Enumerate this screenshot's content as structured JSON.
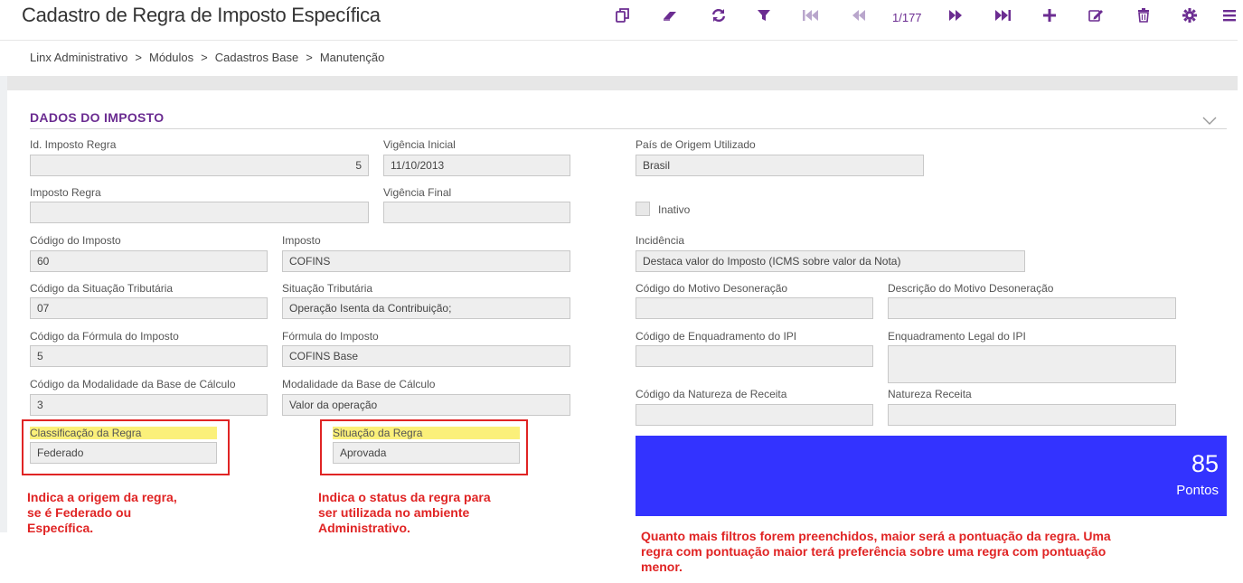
{
  "header": {
    "title": "Cadastro de Regra de Imposto Específica",
    "pager": "1/177"
  },
  "toolbar": {
    "icons": [
      "copy-icon",
      "eraser-icon",
      "refresh-icon",
      "filter-icon",
      "first-record-icon",
      "previous-record-icon",
      "next-record-icon",
      "last-record-icon",
      "add-icon",
      "edit-icon",
      "delete-icon",
      "settings-icon",
      "menu-icon"
    ]
  },
  "breadcrumb": {
    "items": [
      "Linx Administrativo",
      "Módulos",
      "Cadastros Base",
      "Manutenção"
    ],
    "separator": ">"
  },
  "section": {
    "title": "DADOS DO IMPOSTO"
  },
  "fields": {
    "id_imposto_regra": {
      "label": "Id. Imposto Regra",
      "value": "5"
    },
    "vigencia_inicial": {
      "label": "Vigência Inicial",
      "value": "11/10/2013"
    },
    "pais_origem": {
      "label": "País de Origem Utilizado",
      "value": "Brasil"
    },
    "imposto_regra": {
      "label": "Imposto Regra",
      "value": ""
    },
    "vigencia_final": {
      "label": "Vigência Final",
      "value": ""
    },
    "inativo": {
      "label": "Inativo",
      "checked": false
    },
    "codigo_imposto": {
      "label": "Código do Imposto",
      "value": "60"
    },
    "imposto": {
      "label": "Imposto",
      "value": "COFINS"
    },
    "incidencia": {
      "label": "Incidência",
      "value": "Destaca valor do Imposto (ICMS sobre valor da Nota)"
    },
    "codigo_situacao_tributaria": {
      "label": "Código da Situação Tributária",
      "value": "07"
    },
    "situacao_tributaria": {
      "label": "Situação Tributária",
      "value": "Operação Isenta da Contribuição;"
    },
    "codigo_motivo_desoneracao": {
      "label": "Código do Motivo Desoneração",
      "value": ""
    },
    "descricao_motivo_desoneracao": {
      "label": "Descrição do Motivo Desoneração",
      "value": ""
    },
    "codigo_formula_imposto": {
      "label": "Código da Fórmula do Imposto",
      "value": "5"
    },
    "formula_imposto": {
      "label": "Fórmula do Imposto",
      "value": "COFINS Base"
    },
    "codigo_enquadramento_ipi": {
      "label": "Código de Enquadramento do IPI",
      "value": ""
    },
    "enquadramento_legal_ipi": {
      "label": "Enquadramento Legal do IPI",
      "value": ""
    },
    "codigo_modalidade_base": {
      "label": "Código da Modalidade da Base de Cálculo",
      "value": "3"
    },
    "modalidade_base": {
      "label": "Modalidade da Base de Cálculo",
      "value": "Valor da operação"
    },
    "codigo_natureza_receita": {
      "label": "Código da Natureza de Receita",
      "value": ""
    },
    "natureza_receita": {
      "label": "Natureza Receita",
      "value": ""
    },
    "classificacao_regra": {
      "label": "Classificação da Regra",
      "value": "Federado"
    },
    "situacao_regra": {
      "label": "Situação da Regra",
      "value": "Aprovada"
    }
  },
  "score": {
    "value": "85",
    "unit": "Pontos",
    "color": "#3333ff"
  },
  "annotations": {
    "classificacao_lines": [
      "Indica a origem da regra,",
      "se é Federado ou",
      "Específica."
    ],
    "situacao_lines": [
      "Indica o status da regra para",
      "ser utilizada no ambiente",
      "Administrativo."
    ],
    "score_lines": [
      "Quanto mais filtros forem preenchidos, maior será a pontuação da regra. Uma",
      "regra com pontuação maior terá preferência sobre uma regra com pontuação",
      "menor."
    ]
  },
  "colors": {
    "accent": "#6b2c91",
    "annotation": "#e02424",
    "highlight": "#fbf07a"
  }
}
